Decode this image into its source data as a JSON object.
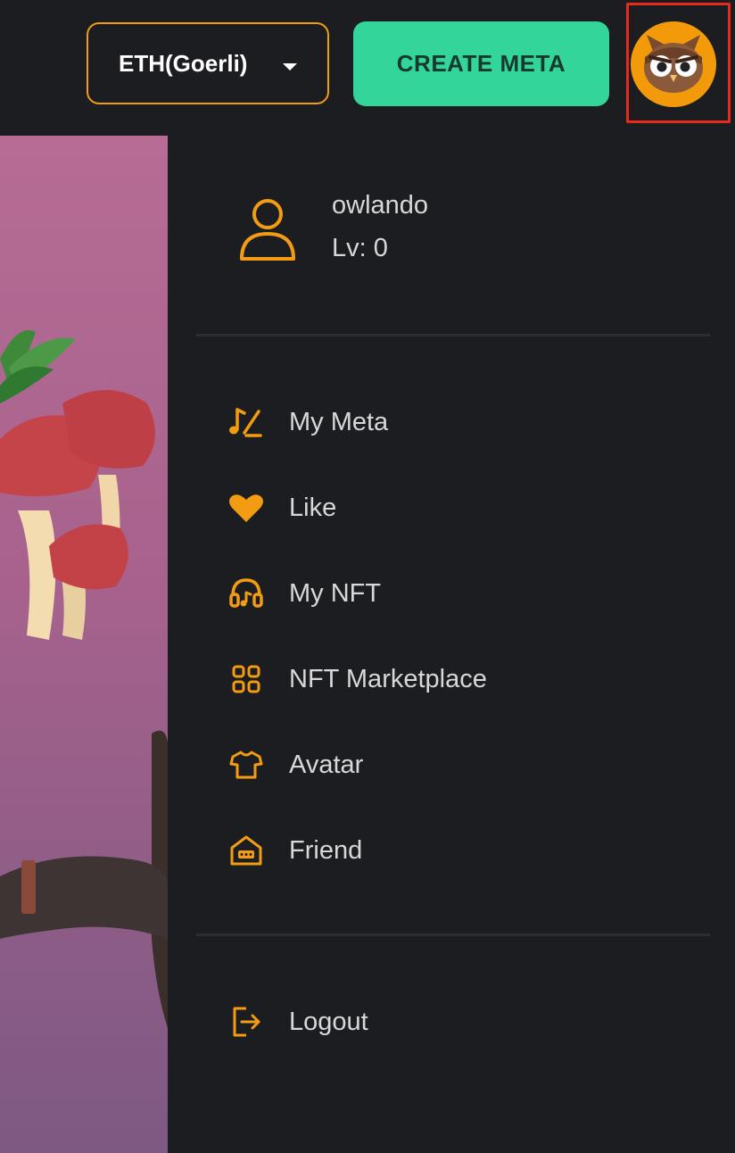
{
  "header": {
    "network_label": "ETH(Goerli)",
    "create_label": "CREATE META"
  },
  "colors": {
    "accent": "#f39c12",
    "create_button": "#34d59b",
    "highlight_frame": "#e8291c",
    "panel_bg": "#1c1d21"
  },
  "profile": {
    "username": "owlando",
    "level": "Lv: 0"
  },
  "menu": {
    "items": [
      {
        "label": "My Meta",
        "icon": "music-edit-icon"
      },
      {
        "label": "Like",
        "icon": "heart-icon"
      },
      {
        "label": "My NFT",
        "icon": "headphones-icon"
      },
      {
        "label": "NFT Marketplace",
        "icon": "grid-icon"
      },
      {
        "label": "Avatar",
        "icon": "tshirt-icon"
      },
      {
        "label": "Friend",
        "icon": "house-chat-icon"
      }
    ],
    "logout_label": "Logout"
  }
}
